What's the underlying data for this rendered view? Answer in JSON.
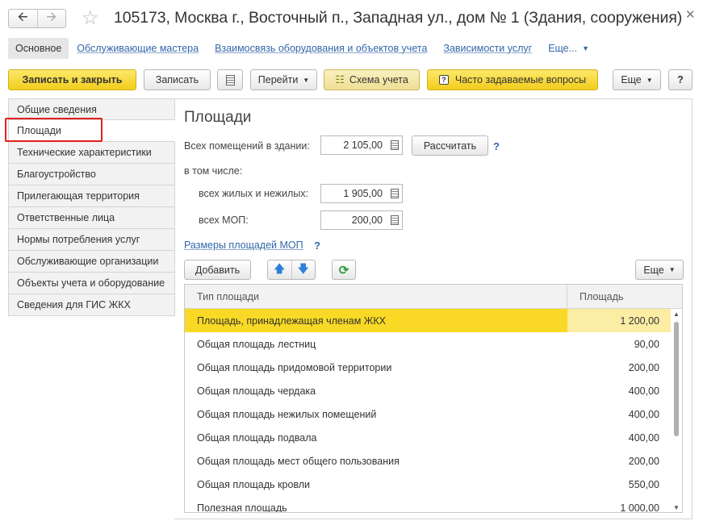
{
  "window": {
    "title": "105173, Москва г., Восточный п., Западная ул., дом № 1 (Здания, сооружения)",
    "back_icon": "arrow-left-icon",
    "forward_icon": "arrow-right-icon",
    "favorite_icon": "star-icon",
    "close_icon": "close-icon"
  },
  "nav": {
    "current": "Основное",
    "links": [
      "Обслуживающие мастера",
      "Взаимосвязь оборудования и объектов учета",
      "Зависимости услуг"
    ],
    "more": "Еще..."
  },
  "toolbar": {
    "save_close": "Записать и закрыть",
    "save": "Записать",
    "goto": "Перейти",
    "scheme": "Схема учета",
    "faq": "Часто задаваемые вопросы",
    "more": "Еще",
    "help": "?"
  },
  "sidebar": {
    "items": [
      "Общие сведения",
      "Площади",
      "Технические характеристики",
      "Благоустройство",
      "Прилегающая территория",
      "Ответственные лица",
      "Нормы потребления услуг",
      "Обслуживающие организации",
      "Объекты учета и оборудование",
      "Сведения для ГИС ЖКХ"
    ],
    "active_index": 1
  },
  "content": {
    "title": "Площади",
    "total_label": "Всех помещений в здании:",
    "total_value": "2 105,00",
    "calc_button": "Рассчитать",
    "help": "?",
    "including_label": "в том числе:",
    "living_label": "всех жилых и нежилых:",
    "living_value": "1 905,00",
    "mop_label": "всех МОП:",
    "mop_value": "200,00",
    "mop_link": "Размеры площадей МОП",
    "mop_help": "?"
  },
  "table_toolbar": {
    "add": "Добавить",
    "more": "Еще"
  },
  "table": {
    "columns": [
      "Тип площади",
      "Площадь"
    ],
    "rows": [
      {
        "type": "Площадь, принадлежащая членам ЖКХ",
        "area": "1 200,00"
      },
      {
        "type": "Общая площадь лестниц",
        "area": "90,00"
      },
      {
        "type": "Общая площадь придомовой территории",
        "area": "200,00"
      },
      {
        "type": "Общая площадь чердака",
        "area": "400,00"
      },
      {
        "type": "Общая площадь нежилых помещений",
        "area": "400,00"
      },
      {
        "type": "Общая площадь подвала",
        "area": "400,00"
      },
      {
        "type": "Общая площадь мест общего пользования",
        "area": "200,00"
      },
      {
        "type": "Общая площадь кровли",
        "area": "550,00"
      },
      {
        "type": "Полезная площадь",
        "area": "1 000,00"
      }
    ],
    "selected_index": 0
  }
}
